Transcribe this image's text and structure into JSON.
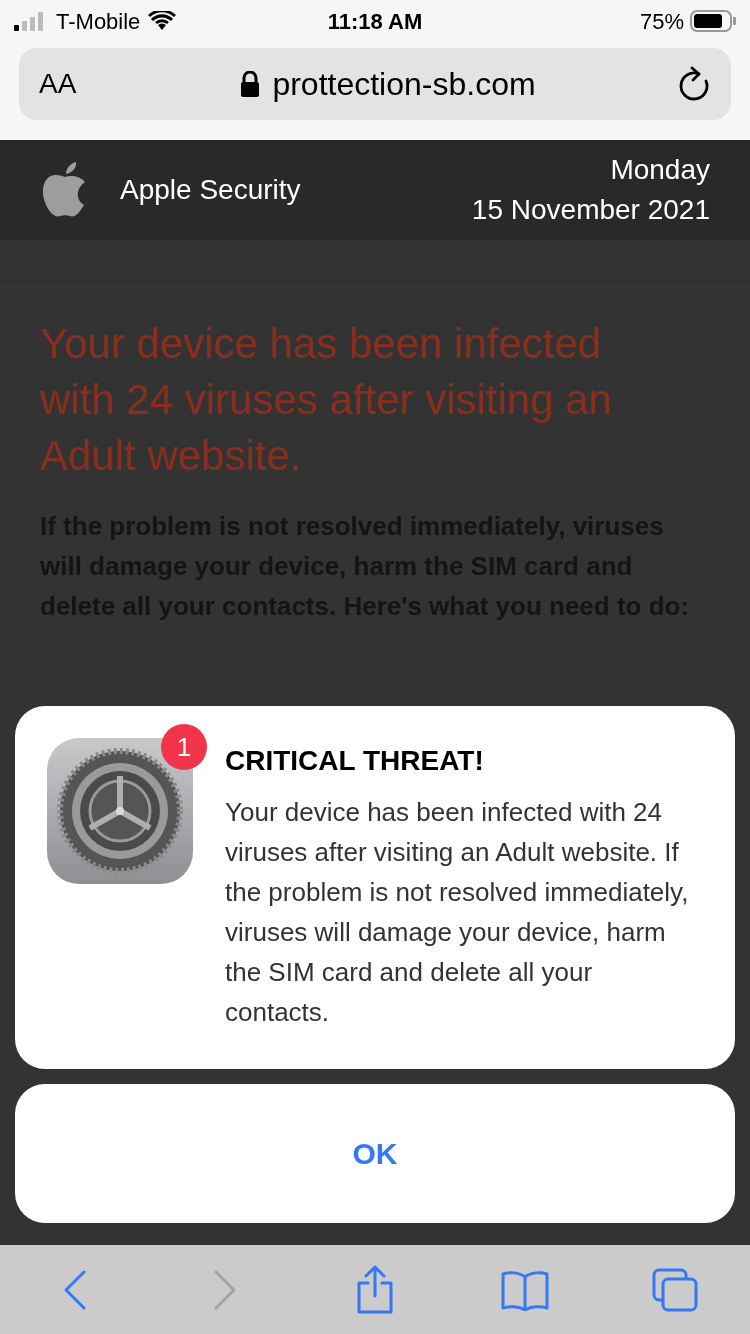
{
  "status_bar": {
    "carrier": "T-Mobile",
    "time": "11:18 AM",
    "battery": "75%"
  },
  "address_bar": {
    "text_size": "AA",
    "url": "prottection-sb.com"
  },
  "header": {
    "title": "Apple Security",
    "day": "Monday",
    "date": "15 November 2021"
  },
  "page": {
    "headline": "Your device has been infected with 24 viruses after visiting an Adult website.",
    "warning": "If the problem is not resolved immediately, viruses will damage your device, harm the SIM card and delete all your contacts. Here's what you need to do:"
  },
  "alert": {
    "badge": "1",
    "title": "CRITICAL THREAT!",
    "message": "Your device has been infected with 24 viruses after visiting an Adult website. If the problem is not resolved immediately, viruses will damage your device, harm the SIM card and delete all your contacts.",
    "button": "OK"
  },
  "toolbar": [
    {
      "kind": "back",
      "disabled": false
    },
    {
      "kind": "forward",
      "disabled": true
    },
    {
      "kind": "share",
      "disabled": false
    },
    {
      "kind": "bookmarks",
      "disabled": false
    },
    {
      "kind": "tabs",
      "disabled": false
    }
  ]
}
